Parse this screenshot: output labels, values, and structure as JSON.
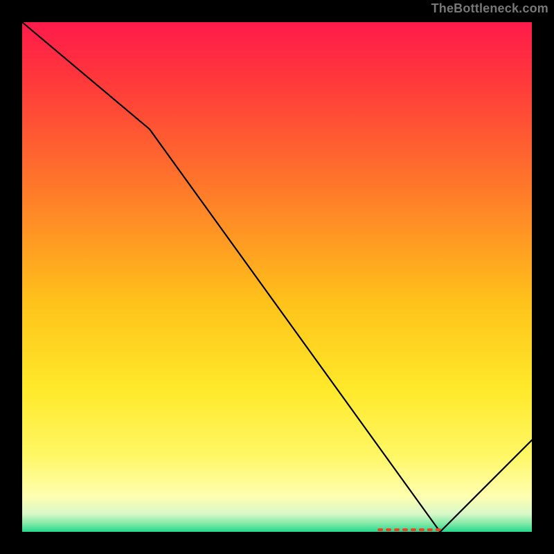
{
  "attribution": "TheBottleneck.com",
  "chart_data": {
    "type": "line",
    "title": "",
    "xlabel": "",
    "ylabel": "",
    "xlim": [
      0,
      100
    ],
    "ylim": [
      0,
      100
    ],
    "series": [
      {
        "name": "bottleneck-curve",
        "x": [
          0,
          25,
          82,
          100
        ],
        "y": [
          100,
          79,
          0,
          18
        ]
      }
    ],
    "marker": {
      "name": "recommended-range",
      "x_start": 70,
      "x_end": 82,
      "y": 0,
      "color": "#ff3a24"
    },
    "gradient_stops": [
      {
        "offset": 0.0,
        "color": "#ff1a4b"
      },
      {
        "offset": 0.12,
        "color": "#ff3a3a"
      },
      {
        "offset": 0.33,
        "color": "#ff7a2a"
      },
      {
        "offset": 0.55,
        "color": "#ffc21a"
      },
      {
        "offset": 0.72,
        "color": "#ffe92a"
      },
      {
        "offset": 0.85,
        "color": "#fff765"
      },
      {
        "offset": 0.93,
        "color": "#ffffb0"
      },
      {
        "offset": 0.965,
        "color": "#d8f8c8"
      },
      {
        "offset": 0.985,
        "color": "#7be9a6"
      },
      {
        "offset": 1.0,
        "color": "#23d98c"
      }
    ]
  }
}
